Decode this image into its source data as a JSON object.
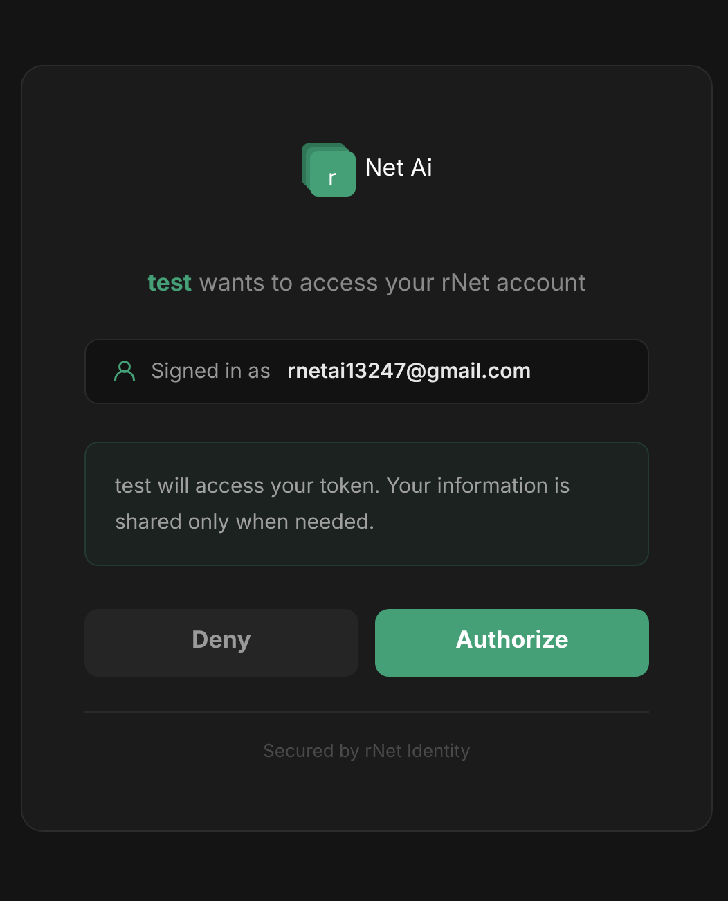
{
  "app": {
    "logo_letter": "r",
    "name": "Net Ai"
  },
  "heading": "**test** wants to access your rNet account",
  "account": {
    "label": "Signed in as",
    "email": "rnetai13247@gmail.com"
  },
  "notice": "test will access your token. Your information is shared only when needed.",
  "buttons": [
    {
      "label": "Deny",
      "kind": "secondary"
    },
    {
      "label": "Authorize",
      "kind": "primary"
    }
  ],
  "footer": "Secured by rNet Identity"
}
